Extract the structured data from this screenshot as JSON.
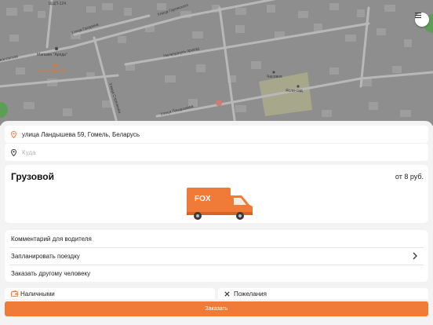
{
  "map": {
    "labels": {
      "street_top": "ЩЦП-124",
      "street_gagarina": "Улица Гагарина",
      "street_garovskaya": "Улица Гаровского",
      "shop": "Магазин \"Ареда\"",
      "pharmacy": "Аптека \"Тризол\"",
      "passage": "Нагарудоусь проезд",
      "chapel": "Часовня",
      "kindergarten": "Ясли-сад",
      "street_landyshev": "Улица Ландышева",
      "street_left": "Ивановская",
      "street_bottom_left": "Улица Стрелкова"
    },
    "menu_icon": "hamburger-menu-icon"
  },
  "route": {
    "from": "улица Ландышева 59, Гомель, Беларусь",
    "to_placeholder": "Куда",
    "from_icon": "location-pin-icon",
    "to_icon": "location-pin-icon"
  },
  "tariff": {
    "name": "Грузовой",
    "price": "от 8 руб.",
    "logo_text": "FOX",
    "image": "fox-cargo-truck"
  },
  "options": {
    "comment": "Комментарий для водителя",
    "schedule": "Запланировать поездку",
    "other_person": "Заказать другому человеку"
  },
  "payment": {
    "method": "Наличными",
    "method_icon": "wallet-icon",
    "wishes": "Пожелания",
    "wishes_icon": "close-x-icon"
  },
  "order_button": "Заказать",
  "colors": {
    "accent": "#f07a37",
    "map_background": "#8e8e8e"
  }
}
